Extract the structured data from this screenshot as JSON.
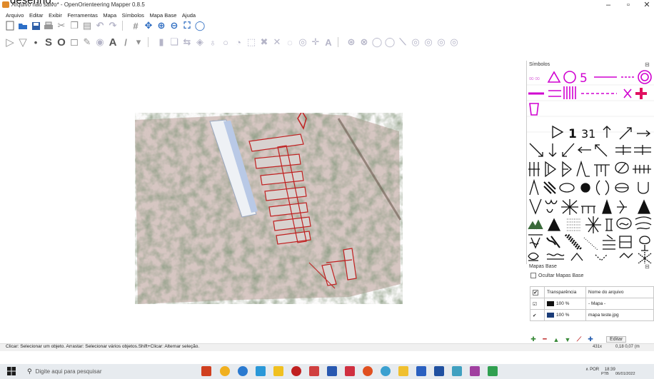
{
  "caption": "desenho.",
  "window": {
    "title": "Arquivo não salvo* - OpenOrienteering Mapper 0.8.5",
    "minimize": "–",
    "maximize": "▫",
    "close": "✕"
  },
  "menu": [
    "Arquivo",
    "Editar",
    "Exibir",
    "Ferramentas",
    "Mapa",
    "Símbolos",
    "Mapa Base",
    "Ajuda"
  ],
  "symbols_panel": {
    "title": "Símbolos",
    "close": "⊟"
  },
  "base_maps_panel": {
    "title": "Mapas Base",
    "close": "⊟",
    "hide_label": "Ocultar Mapas Base",
    "columns": [
      "Transparência",
      "Nome do arquivo"
    ],
    "rows": [
      {
        "checked": "☑",
        "opacity": "100 %",
        "name": "- Mapa -",
        "color": "#111111"
      },
      {
        "checked": "✔",
        "opacity": "100 %",
        "name": "mapa teste.jpg",
        "color": "#1a3c78"
      }
    ],
    "edit_label": "Editar"
  },
  "status": {
    "text": "Clicar: Selecionar um objeto. Arrastar: Selecionar vários objetos.Shift+Clicar: Alternar seleção.",
    "zoom": "431x",
    "coords": "0,18 0,07 (m"
  },
  "taskbar": {
    "search_placeholder": "Digite aqui para pesquisar",
    "lang": "POR",
    "lang2": "PTB",
    "time": "18:39",
    "date": "06/01/2022"
  },
  "colors": {
    "accent": "#d000d0",
    "purple": "#c0209c",
    "black": "#111111"
  }
}
